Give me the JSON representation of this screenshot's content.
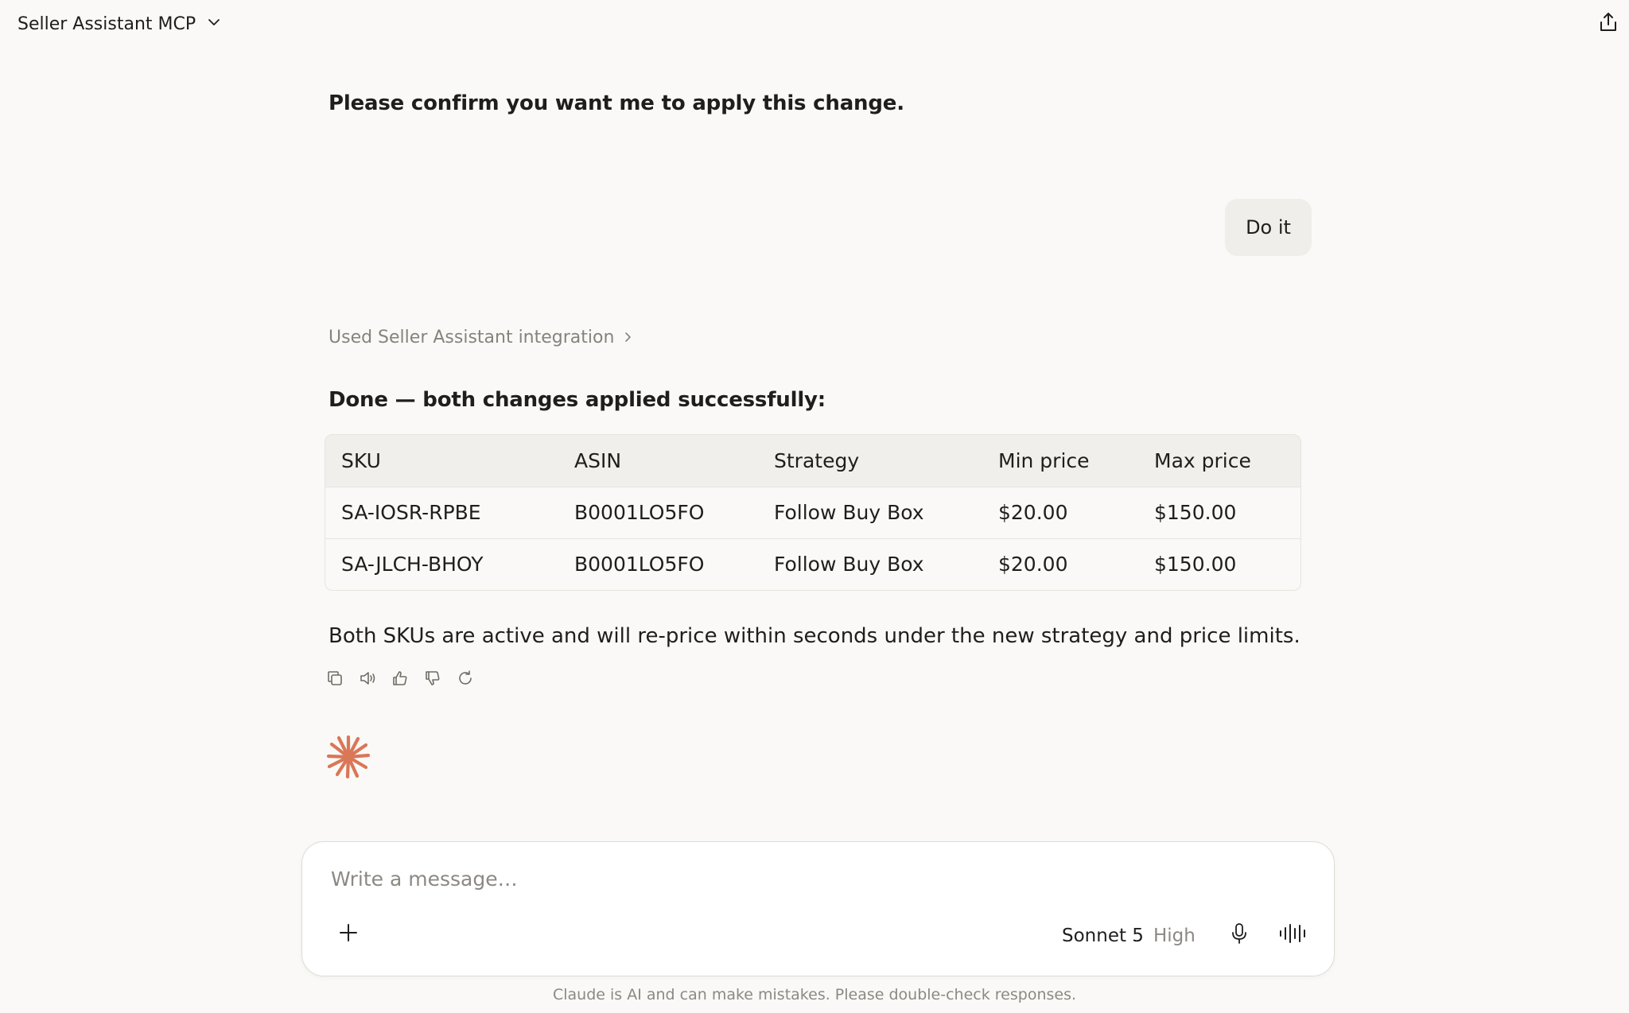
{
  "header": {
    "project_name": "Seller Assistant MCP",
    "chevron_icon": "chevron-down-icon",
    "share_icon": "share-icon"
  },
  "conversation": {
    "assistant_confirm": "Please confirm you want me to apply this change.",
    "user_message": "Do it",
    "tool_use_label": "Used Seller Assistant integration",
    "done_heading": "Done — both changes applied successfully:",
    "table": {
      "headers": [
        "SKU",
        "ASIN",
        "Strategy",
        "Min price",
        "Max price"
      ],
      "rows": [
        [
          "SA-IOSR-RPBE",
          "B0001LO5FO",
          "Follow Buy Box",
          "$20.00",
          "$150.00"
        ],
        [
          "SA-JLCH-BHOY",
          "B0001LO5FO",
          "Follow Buy Box",
          "$20.00",
          "$150.00"
        ]
      ]
    },
    "summary": "Both SKUs are active and will re-price within seconds under the new strategy and price limits.",
    "actions": [
      "copy-icon",
      "speaker-icon",
      "thumbs-up-icon",
      "thumbs-down-icon",
      "retry-icon"
    ]
  },
  "composer": {
    "placeholder": "Write a message…",
    "model_name": "Sonnet 5",
    "model_effort": "High"
  },
  "footer": {
    "disclaimer": "Claude is AI and can make mistakes. Please double-check responses."
  },
  "colors": {
    "background": "#faf9f7",
    "accent": "#d97757",
    "user_bubble": "#efeeea",
    "muted_text": "#8c8983"
  }
}
